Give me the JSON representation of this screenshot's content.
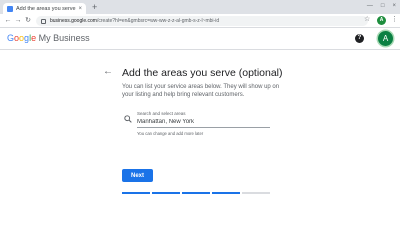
{
  "browser": {
    "tab_title": "Add the areas you serve (optio",
    "tab_close": "×",
    "new_tab": "+",
    "window_controls": [
      "—",
      "□",
      "×"
    ],
    "nav": {
      "back": "←",
      "forward": "→",
      "reload": "↻"
    },
    "url_host": "business.google.com",
    "url_path": "/create?hl=en&gmbsrc=ww-ww-z-z-al-gmb-s-z-l~mbi-id",
    "star": "☆",
    "profile_initial": "A",
    "menu": "⋮"
  },
  "app": {
    "brand_google": "Google",
    "brand_product": "My Business",
    "brand_colors": [
      "#4285F4",
      "#EA4335",
      "#FBBC05",
      "#4285F4",
      "#34A853",
      "#EA4335"
    ],
    "help": "?",
    "avatar_initial": "A"
  },
  "page": {
    "back": "←",
    "title": "Add the areas you serve (optional)",
    "description": "You can list your service areas below. They will show up on your listing and help bring relevant customers.",
    "search": {
      "label": "Search and select areas",
      "value": "Manhattan, New York",
      "hint": "You can change and add more later"
    },
    "next_label": "Next",
    "progress": {
      "total_steps": 5,
      "completed_steps": 4
    }
  },
  "colors": {
    "accent": "#1a73e8",
    "avatar": "#0b8043"
  }
}
